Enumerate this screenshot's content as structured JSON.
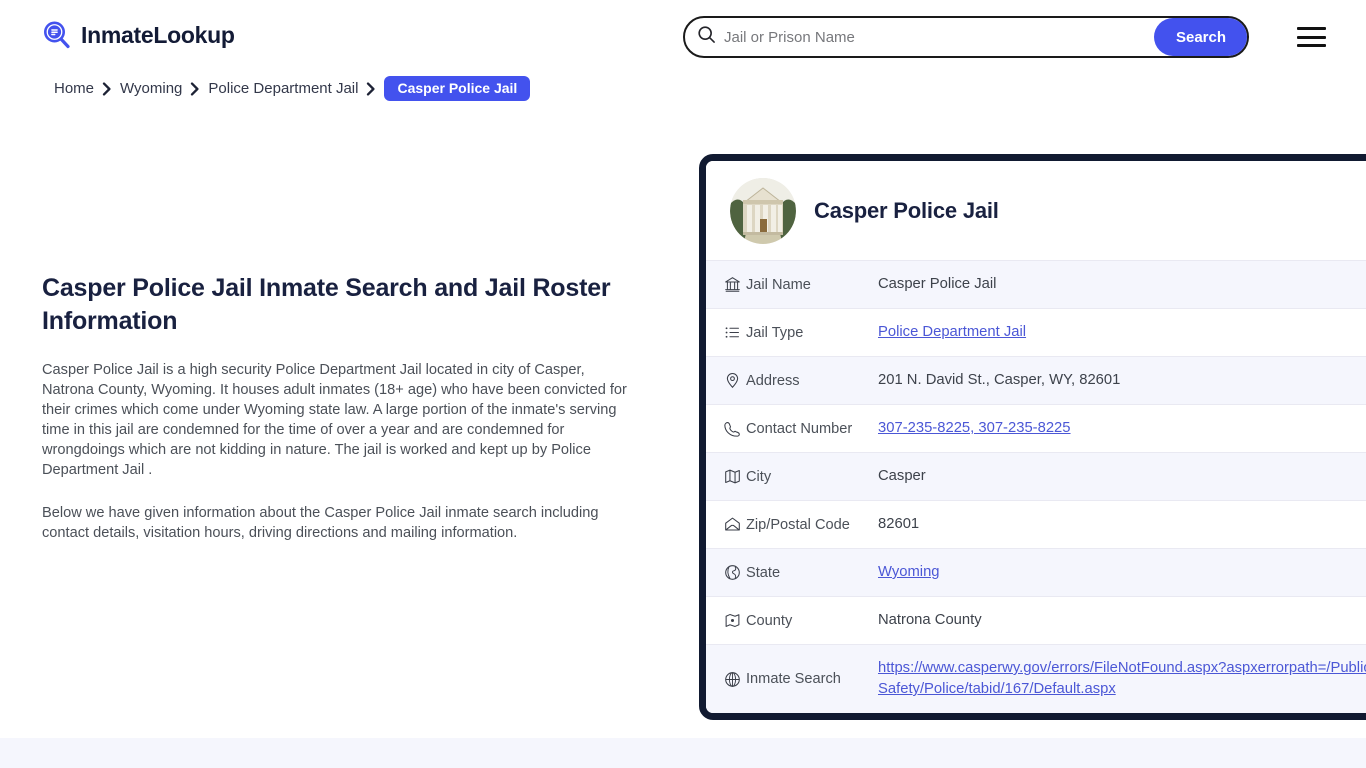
{
  "header": {
    "brand_name": "InmateLookup",
    "brand_icon": "search-list-logo-icon",
    "search": {
      "placeholder": "Jail or Prison Name",
      "value": "",
      "button_label": "Search",
      "icon": "search-icon"
    },
    "menu_icon": "hamburger-menu-icon"
  },
  "breadcrumb": {
    "items": [
      {
        "label": "Home",
        "current": false
      },
      {
        "label": "Wyoming",
        "current": false
      },
      {
        "label": "Police Department Jail",
        "current": false
      },
      {
        "label": "Casper Police Jail",
        "current": true
      }
    ]
  },
  "main": {
    "title": "Casper Police Jail Inmate Search and Jail Roster Information",
    "paragraph_1": "Casper Police Jail is a high security Police Department Jail located in city of Casper, Natrona County, Wyoming. It houses adult inmates (18+ age) who have been convicted for their crimes which come under Wyoming state law. A large portion of the inmate's serving time in this jail are condemned for the time of over a year and are condemned for wrongdoings which are not kidding in nature. The jail is worked and kept up by Police Department Jail .",
    "paragraph_2": "Below we have given information about the Casper Police Jail inmate search including contact details, visitation hours, driving directions and mailing information."
  },
  "card": {
    "title": "Casper Police Jail",
    "photo_alt": "courthouse-building-photo",
    "rows": [
      {
        "icon": "bank-icon",
        "label": "Jail Name",
        "value": "Casper Police Jail",
        "is_link": false
      },
      {
        "icon": "list-icon",
        "label": "Jail Type",
        "value": "Police Department Jail",
        "is_link": true
      },
      {
        "icon": "map-pin-icon",
        "label": "Address",
        "value": "201 N. David St., Casper, WY, 82601",
        "is_link": false
      },
      {
        "icon": "phone-icon",
        "label": "Contact Number",
        "value": "307-235-8225, 307-235-8225",
        "is_link": true
      },
      {
        "icon": "map-icon",
        "label": "City",
        "value": "Casper",
        "is_link": false
      },
      {
        "icon": "envelope-icon",
        "label": "Zip/Postal Code",
        "value": "82601",
        "is_link": false
      },
      {
        "icon": "globe-icon",
        "label": "State",
        "value": "Wyoming",
        "is_link": true
      },
      {
        "icon": "region-icon",
        "label": "County",
        "value": "Natrona County",
        "is_link": false
      },
      {
        "icon": "web-icon",
        "label": "Inmate Search",
        "value": "https://www.casperwy.gov/errors/FileNotFound.aspx?aspxerrorpath=/PublicSafety/Police/tabid/167/Default.aspx",
        "is_link": true
      }
    ]
  },
  "colors": {
    "accent_blue": "#4352ee",
    "link_blue": "#4b57d6",
    "dark_navy": "#111a31",
    "heading_navy": "#192140",
    "row_alt_bg": "#f5f6fd",
    "body_text": "#4b5058"
  }
}
